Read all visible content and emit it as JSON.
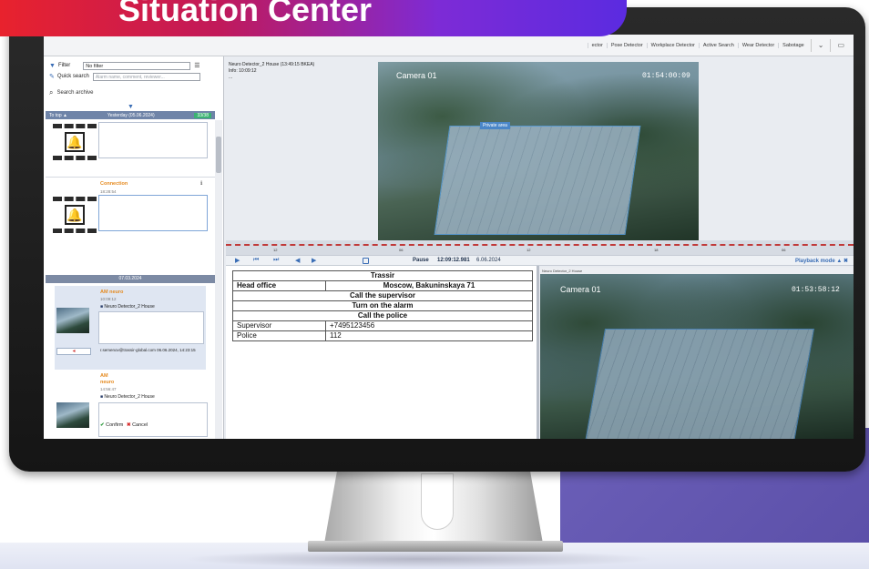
{
  "banner": {
    "title": "Situation Center"
  },
  "toolbar": {
    "items": [
      "ector",
      "Pose Detector",
      "Workplace Detector",
      "Active Search",
      "Wear Detector",
      "Sabotage"
    ]
  },
  "left_panel": {
    "filter_label": "Filter",
    "filter_value": "No filter",
    "quick_search_label": "Quick search",
    "quick_search_placeholder": "Alarm name, comment, reviewer...",
    "search_archive": "Search archive",
    "to_top": "To top",
    "day_header": "Yesterday (05.06.2024)",
    "day_count": "33/38",
    "events": [
      {
        "title": "",
        "time": ""
      },
      {
        "title": "Connection",
        "time": "18:28:54"
      }
    ],
    "date_divider": "07.03.2024",
    "selected_event": {
      "title": "AM neuro",
      "time": "10:09:12",
      "source": "Neuro Detector_2 House",
      "reviewer": "r.semenov@trassir-global.com 06.06.2024, 14:23:15"
    },
    "last_event": {
      "title": "AM",
      "subtitle": "neuro",
      "time": "14:56:47",
      "source": "Neuro Detector_2 House"
    },
    "confirm_label": "Confirm",
    "cancel_label": "Cancel"
  },
  "video_main": {
    "info": [
      "Neuro Detector_2 House (13:49:15 BKEA)",
      "Info: 10:09:12",
      "..."
    ],
    "camera_label": "Camera 01",
    "camera_time": "01:54:00:09",
    "private_area": "Private area"
  },
  "timeline": {
    "ticks": [
      "12",
      "06",
      "12",
      "18",
      "06"
    ]
  },
  "controls": {
    "state": "Pause",
    "time": "12:09:12.981",
    "date": "6.06.2024",
    "mode": "Playback mode"
  },
  "info_table": {
    "title": "Trassir",
    "office_label": "Head office",
    "office_address": "Moscow, Bakuninskaya 71",
    "actions": [
      "Call the supervisor",
      "Turn on the alarm",
      "Call the police"
    ],
    "contacts": [
      {
        "label": "Supervisor",
        "value": "+7495123456"
      },
      {
        "label": "Police",
        "value": "112"
      }
    ]
  },
  "video_second": {
    "header": "Neuro Detector_2 House",
    "camera_label": "Camera 01",
    "camera_time": "01:53:58:12"
  }
}
